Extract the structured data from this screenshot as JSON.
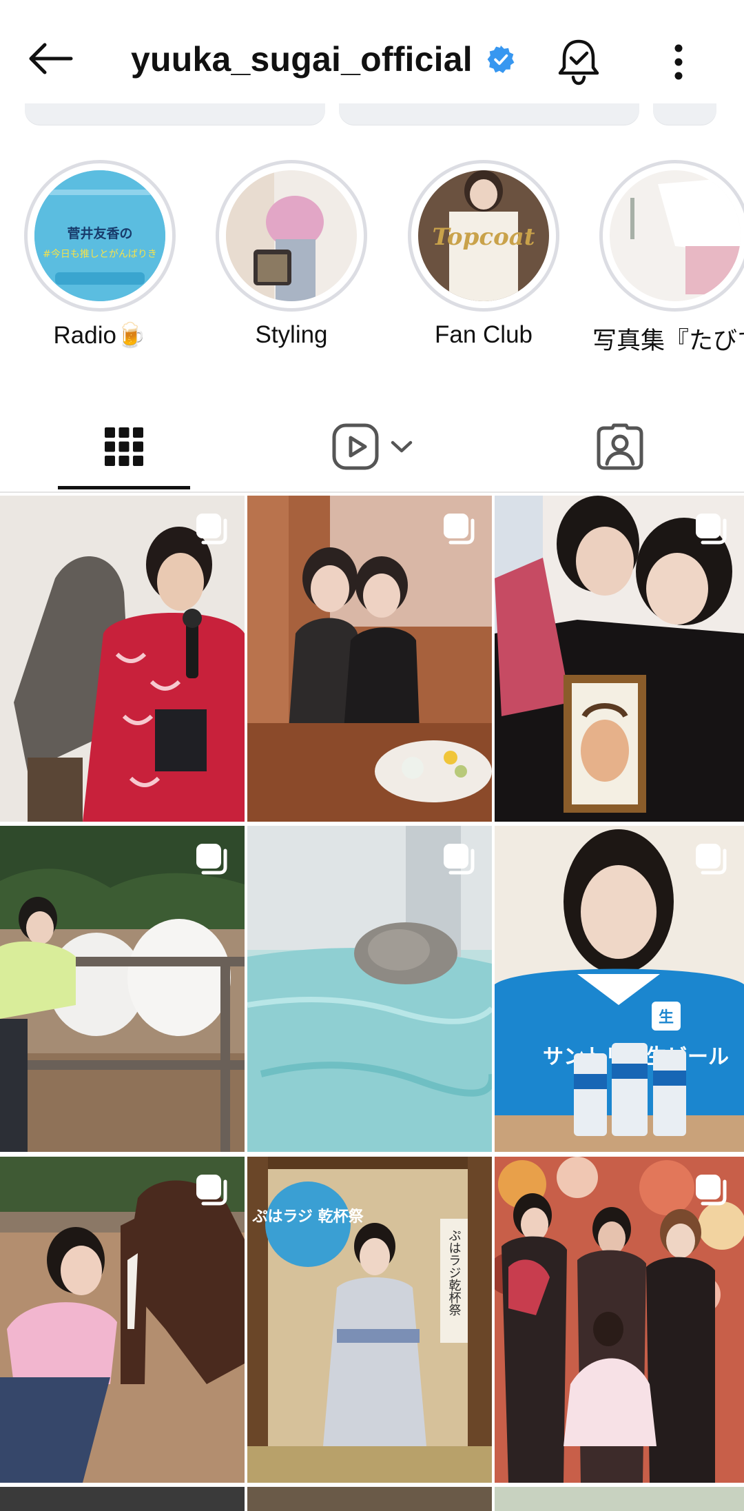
{
  "header": {
    "username": "yuuka_sugai_official",
    "verified": true,
    "icons": [
      "back-arrow-icon",
      "verified-badge-icon",
      "notification-bell-icon",
      "more-options-icon"
    ]
  },
  "highlights": [
    {
      "label": "Radio🍺",
      "cover_text": "菅井友香の #今日も推しとがんばりき"
    },
    {
      "label": "Styling"
    },
    {
      "label": "Fan Club",
      "cover_text": "Topcoat"
    },
    {
      "label": "写真集『たびす"
    }
  ],
  "tabs": [
    {
      "name": "posts",
      "icon": "grid-icon",
      "selected": true
    },
    {
      "name": "reels",
      "icon": "reels-icon"
    },
    {
      "name": "tagged",
      "icon": "tagged-person-icon"
    }
  ],
  "posts": [
    {
      "multi": true,
      "subject": "kimono-microphone"
    },
    {
      "multi": true,
      "subject": "two-friends-dinner"
    },
    {
      "multi": true,
      "subject": "hug-portrait"
    },
    {
      "multi": true,
      "subject": "white-ponies"
    },
    {
      "multi": true,
      "subject": "seal-water"
    },
    {
      "multi": true,
      "subject": "blue-shirt-cans",
      "sign_text": "サントリー生ビール",
      "can_text": "生"
    },
    {
      "multi": true,
      "subject": "horse-pink-shirt"
    },
    {
      "multi": false,
      "subject": "kimono-tatami",
      "logo_text": "ぷはラジ 乾杯祭",
      "scroll_text": "ぷはラジ乾杯祭"
    },
    {
      "multi": true,
      "subject": "group-flowers"
    }
  ],
  "colors": {
    "verified": "#3797f0",
    "text": "#111111",
    "divider": "#e4e4e4",
    "ring": "#dcdde3"
  }
}
